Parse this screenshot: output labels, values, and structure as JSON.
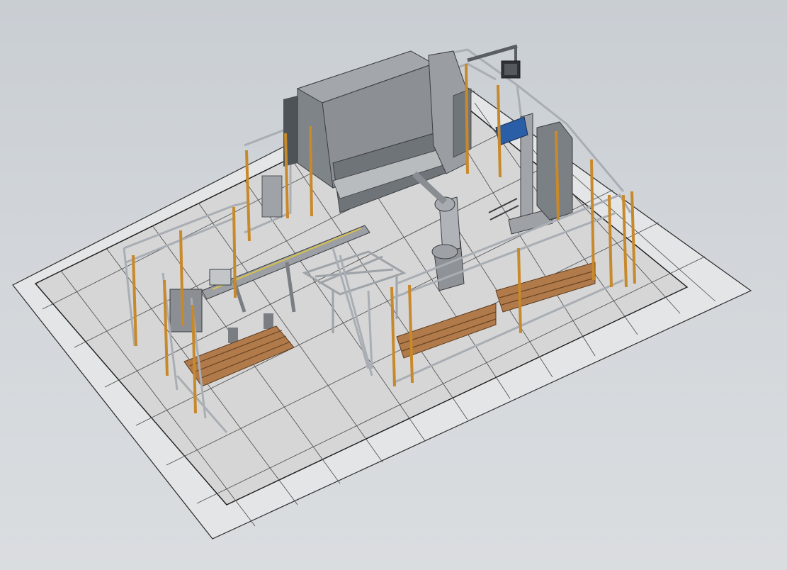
{
  "viewport": {
    "background_top": "#c9ced3",
    "background_bottom": "#dadde0",
    "floor_color": "#d8d8d8",
    "grid_line_color": "#2a2a2a",
    "post_color": "#c8892b",
    "fence_color": "#b9bec4",
    "machine_color": "#8f9398",
    "machine_dark": "#5a5e63",
    "pallet_color": "#b07a4a",
    "accent_blue": "#2a5fa8"
  },
  "scene_objects": [
    "press-brake",
    "industrial-robot",
    "gantry-loader",
    "safety-fence",
    "pallet-stack",
    "conveyor-rack",
    "control-cabinet",
    "tool-rack",
    "monitor-arm"
  ]
}
